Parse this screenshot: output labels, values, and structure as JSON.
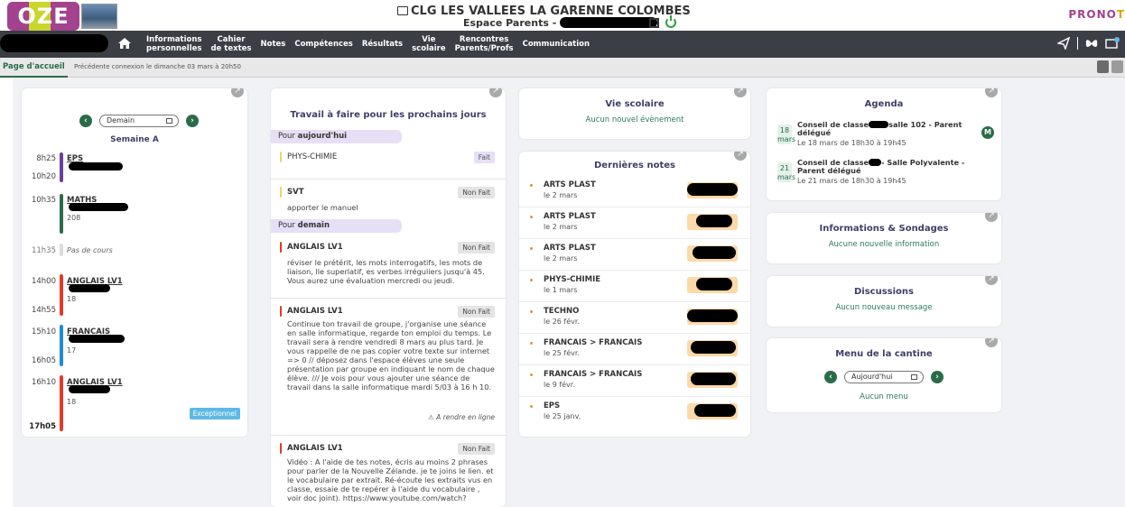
{
  "header": {
    "logo_text": "OZE",
    "school_name": "CLG LES VALLEES LA GARENNE COLOMBES",
    "space_label": "Espace Parents -",
    "brand": [
      "PRONO",
      "T"
    ]
  },
  "nav": {
    "items": [
      "Informations\npersonnelles",
      "Cahier\nde textes",
      "Notes",
      "Compétences",
      "Résultats",
      "Vie\nscolaire",
      "Rencontres\nParents/Profs",
      "Communication"
    ]
  },
  "subbar": {
    "tab_home": "Page d'accueil",
    "last_login": "Précédente connexion le dimanche 03 mars à 20h50"
  },
  "timetable": {
    "date_value": "Demain",
    "week": "Semaine A",
    "lessons": [
      {
        "start": "8h25",
        "end": "10h20",
        "subject": "EPS",
        "room": ""
      },
      {
        "start": "10h35",
        "end": "",
        "subject": "MATHS",
        "room": "208"
      },
      {
        "start": "11h35",
        "end": "",
        "subject": "",
        "room": "",
        "nocourse": "Pas de cours"
      },
      {
        "start": "14h00",
        "end": "14h55",
        "subject": "ANGLAIS LV1",
        "room": "18"
      },
      {
        "start": "15h10",
        "end": "16h05",
        "subject": "FRANCAIS",
        "room": "17"
      },
      {
        "start": "16h10",
        "end": "17h05",
        "subject": "ANGLAIS LV1",
        "room": "18"
      }
    ],
    "exceptional": "Exceptionnel",
    "colors": {
      "eps": "#6a3fa0",
      "maths": "#2a6c48",
      "anglais": "#e53828",
      "francais": "#1f8dd6"
    }
  },
  "homework": {
    "title": "Travail à faire pour les prochains jours",
    "today_prefix": "Pour ",
    "today_day": "aujourd'hui",
    "tomorrow_prefix": "Pour ",
    "tomorrow_day": "demain",
    "items": [
      {
        "subject": "PHYS-CHIMIE",
        "status": "Fait",
        "text": ""
      },
      {
        "subject": "SVT",
        "status": "Non Fait",
        "text": "apporter le manuel"
      },
      {
        "subject": "ANGLAIS LV1",
        "status": "Non Fait",
        "text": "réviser le prétérit, les mots interrogatifs, les mots de liaison, lle superlatif, es verbes irréguliers jusqu'à 45. Vous aurez une évaluation mercredi ou jeudi."
      },
      {
        "subject": "ANGLAIS LV1",
        "status": "Non Fait",
        "text": "Continue ton travail de groupe, j'organise une séance en salle informatique, regarde ton emploi du temps. Le travail sera à rendre vendredi 8 mars au plus tard. Je vous rappelle de ne pas copier votre texte sur internet => 0 // déposez dans l'espace élèves une seule présentation par groupe en indiquant le nom de chaque élève. /// Je vois pour vous ajouter une séance de travail dans la salle informatique mardi 5/03 à 16 h 10."
      },
      {
        "subject": "ANGLAIS LV1",
        "status": "Non Fait",
        "text": "Vidéo : A l'aide de tes notes, écris au moins 2 phrases pour parler de la Nouvelle Zélande. je te joins le lien. et le vocabulaire par extrait. Ré-écoute les extraits vus en classe, essaie de te repérer à l'aide du vocabulaire , voir doc joint). https://www.youtube.com/watch?"
      }
    ],
    "online_label": "A rendre en ligne"
  },
  "vie_scolaire": {
    "title": "Vie scolaire",
    "empty": "Aucun nouvel évènement"
  },
  "grades": {
    "title": "Dernières notes",
    "rows": [
      {
        "subject": "ARTS PLAST",
        "date": "le 2 mars"
      },
      {
        "subject": "ARTS PLAST",
        "date": "le 2 mars"
      },
      {
        "subject": "ARTS PLAST",
        "date": "le 2 mars"
      },
      {
        "subject": "PHYS-CHIMIE",
        "date": "le 1 mars"
      },
      {
        "subject": "TECHNO",
        "date": "le 26 févr."
      },
      {
        "subject": "FRANCAIS > FRANCAIS",
        "date": "le 25 févr."
      },
      {
        "subject": "FRANCAIS > FRANCAIS",
        "date": "le 9 févr."
      },
      {
        "subject": "EPS",
        "date": "le 25 janv."
      }
    ]
  },
  "agenda": {
    "title": "Agenda",
    "events": [
      {
        "day": "18",
        "month": "mars",
        "title_a": "Conseil de classe",
        "title_b": "salle 102 - Parent délégué",
        "time": "Le 18 mars de 18h30 à 19h45",
        "badge": "M"
      },
      {
        "day": "21",
        "month": "mars",
        "title_a": "Conseil de classe",
        "title_b": "- Salle Polyvalente - Parent délégué",
        "time": "Le 21 mars de 18h30 à 19h45",
        "badge": ""
      }
    ]
  },
  "informations": {
    "title": "Informations & Sondages",
    "empty": "Aucune nouvelle information"
  },
  "discussions": {
    "title": "Discussions",
    "empty": "Aucun nouveau message"
  },
  "cantine": {
    "title": "Menu de la cantine",
    "date_value": "Aujourd'hui",
    "empty": "Aucun menu"
  }
}
